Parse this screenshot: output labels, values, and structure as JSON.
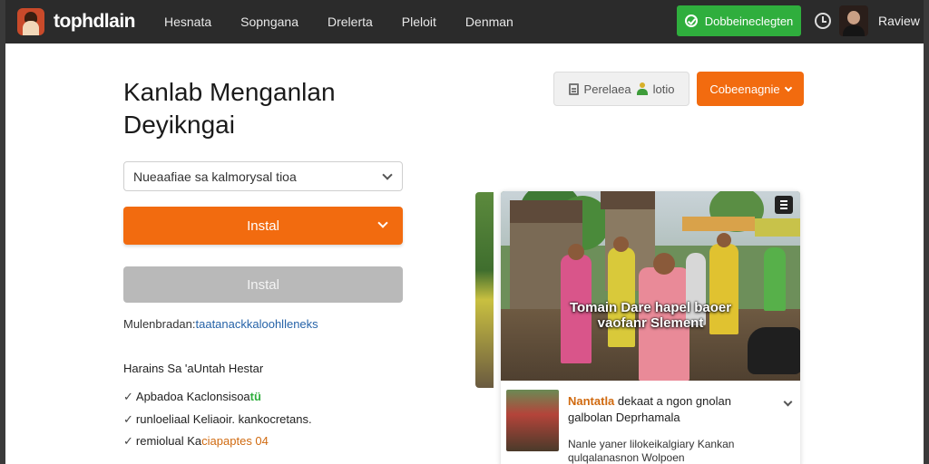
{
  "header": {
    "logo_text": "tophdlain",
    "nav": [
      "Hesnata",
      "Sopngana",
      "Drelerta",
      "Pleloit",
      "Denman"
    ],
    "cta_label": "Dobbeineclegten",
    "user_name": "Raview",
    "accent_color": "#2fae3d"
  },
  "main": {
    "title": "Kanlab Menganlan Deyikngai",
    "select_value": "Nueaafiae sa kalmorysal tioa",
    "primary_button": "Instal",
    "secondary_button": "Instal",
    "hint_prefix": "Mulenbradan:",
    "hint_link": "taatanackkaloohlleneks",
    "section_title": "Harains Sa 'aUntah Hestar",
    "features": [
      {
        "text": "Apbadoa Kaclonsisoa",
        "suffix": "tü"
      },
      {
        "text": "runloeliaal Keliaoir. kankocretans."
      },
      {
        "text": "remiolual Ka",
        "highlight": "ciapaptes 04"
      }
    ]
  },
  "actions": {
    "pill_label_a": "Perelaea",
    "pill_label_b": "lotio",
    "orange_label": "Cobeenagnie"
  },
  "media": {
    "overlay_line1": "Tomain Dare hapel baoer",
    "overlay_line2": "vaofanr Slement",
    "card_title_hl": "Nantatla",
    "card_title_rest": " dekaat a ngon gnolan galbolan Deprhamala",
    "card_desc": "Nanle yaner lilokeikalgiary Kankan qulqalanasnon Wolpoen"
  },
  "colors": {
    "orange": "#f26b0f",
    "green": "#2fae3d",
    "link": "#2663a8"
  }
}
